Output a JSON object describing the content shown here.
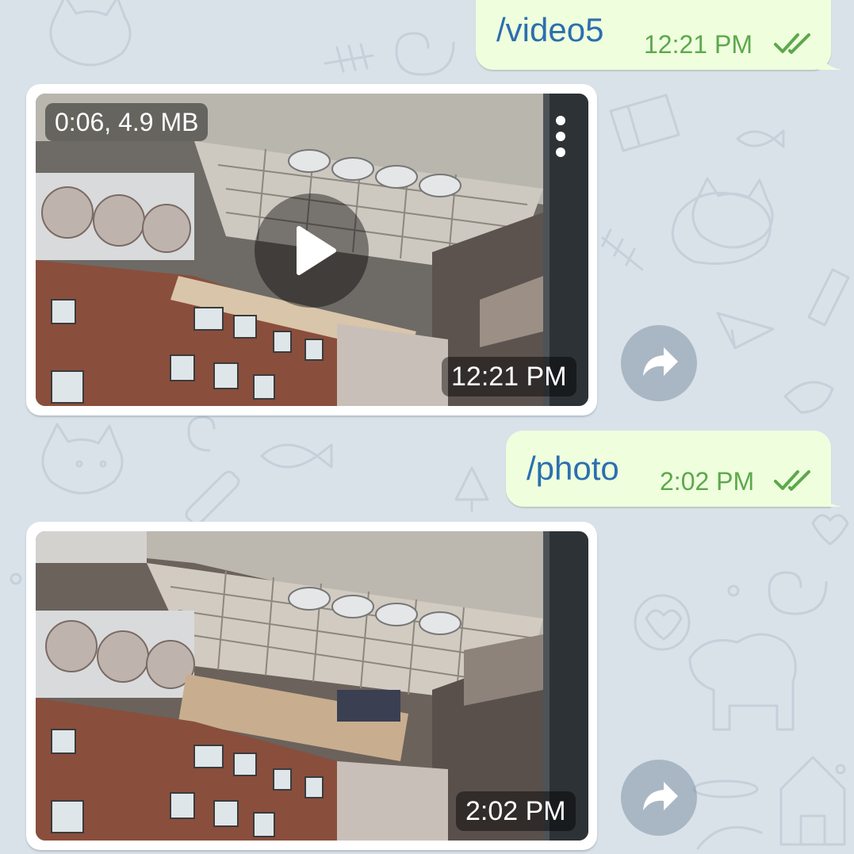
{
  "messages": {
    "video_command": {
      "text": "/video5",
      "time": "12:21 PM",
      "status_icon": "double-check-icon"
    },
    "video_media": {
      "info": "0:06, 4.9 MB",
      "time": "12:21 PM",
      "play_icon": "play-icon",
      "menu_icon": "more-vertical-icon",
      "share_icon": "share-arrow-icon"
    },
    "photo_command": {
      "text": "/photo",
      "time": "2:02 PM",
      "status_icon": "double-check-icon"
    },
    "photo_media": {
      "time": "2:02 PM",
      "share_icon": "share-arrow-icon"
    }
  },
  "colors": {
    "chat_background": "#d9e2e9",
    "outgoing_bubble": "#efffde",
    "outgoing_text": "#2b6fae",
    "outgoing_time": "#5da84c",
    "incoming_bubble": "#ffffff"
  }
}
